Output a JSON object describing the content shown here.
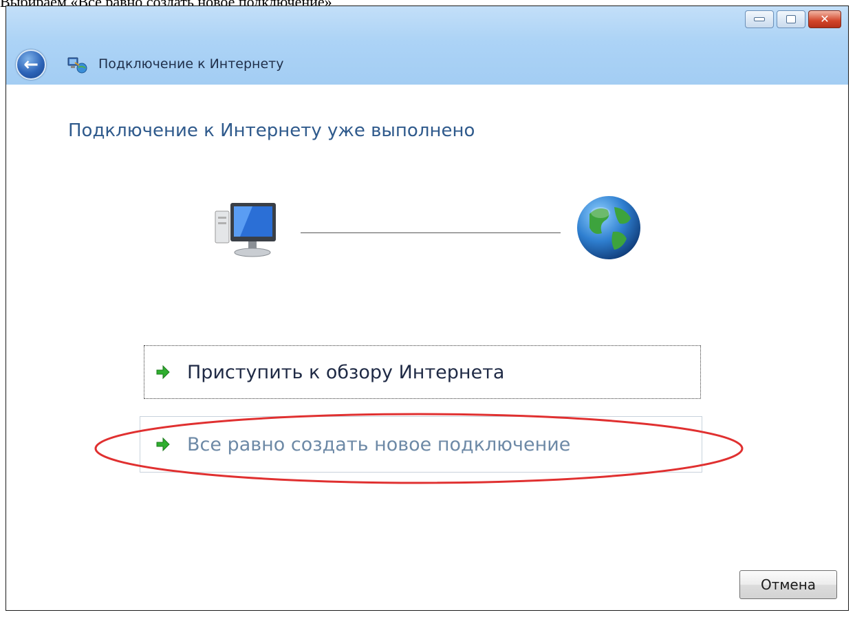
{
  "caption": "Выбираем «Все равно создать новое подключение»",
  "window": {
    "title": "Подключение к Интернету",
    "heading": "Подключение к Интернету уже выполнено"
  },
  "commands": [
    {
      "label": "Приступить к обзору Интернета"
    },
    {
      "label": "Все равно создать новое подключение"
    }
  ],
  "footer": {
    "cancel_label": "Отмена"
  },
  "icons": {
    "back": "back-arrow-icon",
    "title": "network-connection-icon",
    "computer": "computer-icon",
    "globe": "globe-icon",
    "command_arrow": "green-arrow-icon"
  },
  "colors": {
    "titlebar": "#a3cdf3",
    "heading": "#2f5a8c",
    "highlight_ellipse": "#e03030"
  }
}
